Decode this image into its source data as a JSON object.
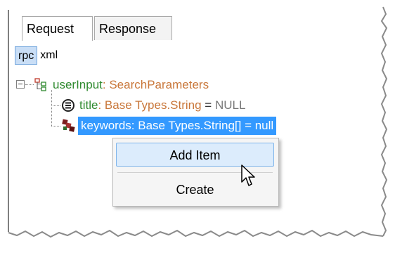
{
  "tabs": [
    {
      "label": "Request",
      "active": true
    },
    {
      "label": "Response",
      "active": false
    }
  ],
  "subtabs": [
    {
      "label": "rpc",
      "active": true
    },
    {
      "label": "xml",
      "active": false
    }
  ],
  "tree": {
    "root": {
      "name": "userInput",
      "sep": ": ",
      "type": "SearchParameters",
      "icon": "struct-icon"
    },
    "title": {
      "name": "title",
      "sep": ": ",
      "type": "Base Types.String",
      "eq": " = ",
      "value": "NULL",
      "icon": "string-field-icon"
    },
    "keywords": {
      "text": "keywords: Base Types.String[] = null",
      "icon": "array-field-icon"
    }
  },
  "context_menu": {
    "items": [
      {
        "label": "Add Item"
      },
      {
        "label": "Create"
      }
    ]
  },
  "colors": {
    "accent_selection": "#3399ff",
    "name_green": "#2f8a2f",
    "type_orange": "#c9773a",
    "menu_hover": "#dcecfc"
  }
}
